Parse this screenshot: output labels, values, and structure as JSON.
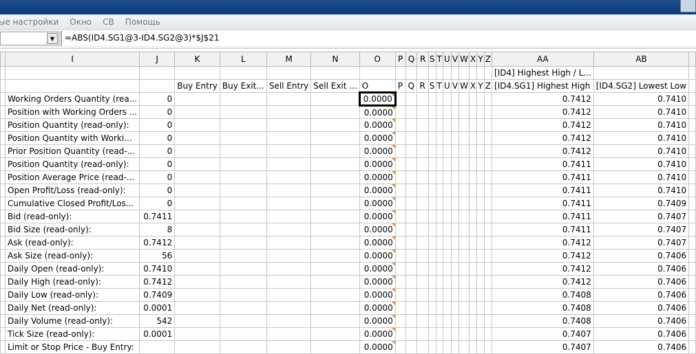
{
  "menu": [
    "ые настройки",
    "Окно",
    "СВ",
    "Помощь"
  ],
  "formula": "=ABS(ID4.SG1@3-ID4.SG2@3)*$J$21",
  "columns": [
    "",
    "I",
    "J",
    "K",
    "L",
    "M",
    "N",
    "O",
    "P",
    "Q",
    "R",
    "S",
    "T",
    "U",
    "V",
    "W",
    "X",
    "Y",
    "Z",
    "AA",
    "AB",
    ""
  ],
  "header_row1": {
    "AA": "[ID4] Highest High / L..."
  },
  "header_row2": [
    "",
    "",
    "",
    "Buy Entry",
    "Buy Exit...",
    "Sell Entry",
    "Sell Exit ...",
    "O",
    "P",
    "Q",
    "R",
    "S",
    "T",
    "U",
    "V",
    "W",
    "X",
    "Y",
    "Z",
    "[ID4.SG1] Highest High",
    "[ID4.SG2] Lowest Low",
    ""
  ],
  "rows": [
    {
      "label": "Working Orders Quantity (rea...",
      "j": "0",
      "o": "0.0000",
      "aa": "0.7412",
      "ab": "0.7410"
    },
    {
      "label": "Position with Working Orders ...",
      "j": "0",
      "o": "0.0000",
      "aa": "0.7412",
      "ab": "0.7410"
    },
    {
      "label": "Position Quantity (read-only):",
      "j": "0",
      "o": "0.0000",
      "aa": "0.7412",
      "ab": "0.7410"
    },
    {
      "label": "Position Quantity with Worki...",
      "j": "0",
      "o": "0.0000",
      "aa": "0.7412",
      "ab": "0.7410"
    },
    {
      "label": "Prior Position Quantity (read-...",
      "j": "0",
      "o": "0.0000",
      "aa": "0.7412",
      "ab": "0.7410"
    },
    {
      "label": "Position Quantity (read-only):",
      "j": "0",
      "o": "0.0000",
      "aa": "0.7411",
      "ab": "0.7410"
    },
    {
      "label": "Position Average Price (read-...",
      "j": "0",
      "o": "0.0000",
      "aa": "0.7411",
      "ab": "0.7410"
    },
    {
      "label": "Open Profit/Loss (read-only):",
      "j": "0",
      "o": "0.0000",
      "aa": "0.7411",
      "ab": "0.7410"
    },
    {
      "label": "Cumulative Closed Profit/Los...",
      "j": "0",
      "o": "0.0000",
      "aa": "0.7411",
      "ab": "0.7409"
    },
    {
      "label": "Bid (read-only):",
      "j": "0.7411",
      "o": "0.0000",
      "aa": "0.7411",
      "ab": "0.7407"
    },
    {
      "label": "Bid Size (read-only):",
      "j": "8",
      "o": "0.0000",
      "aa": "0.7411",
      "ab": "0.7407"
    },
    {
      "label": "Ask (read-only):",
      "j": "0.7412",
      "o": "0.0000",
      "aa": "0.7412",
      "ab": "0.7407"
    },
    {
      "label": "Ask Size (read-only):",
      "j": "56",
      "o": "0.0000",
      "aa": "0.7412",
      "ab": "0.7406"
    },
    {
      "label": "Daily Open (read-only):",
      "j": "0.7410",
      "o": "0.0000",
      "aa": "0.7412",
      "ab": "0.7406"
    },
    {
      "label": "Daily High (read-only):",
      "j": "0.7412",
      "o": "0.0000",
      "aa": "0.7412",
      "ab": "0.7406"
    },
    {
      "label": "Daily Low (read-only):",
      "j": "0.7409",
      "o": "0.0000",
      "aa": "0.7408",
      "ab": "0.7406"
    },
    {
      "label": "Daily Net (read-only):",
      "j": "0.0001",
      "o": "0.0000",
      "aa": "0.7408",
      "ab": "0.7406"
    },
    {
      "label": "Daily Volume (read-only):",
      "j": "542",
      "o": "0.0000",
      "aa": "0.7408",
      "ab": "0.7406"
    },
    {
      "label": "Tick Size (read-only):",
      "j": "0.0001",
      "o": "0.0000",
      "aa": "0.7407",
      "ab": "0.7406"
    },
    {
      "label": "Limit or Stop Price - Buy Entry:",
      "j": "",
      "o": "0.0000",
      "aa": "0.7407",
      "ab": "0.7406"
    }
  ]
}
